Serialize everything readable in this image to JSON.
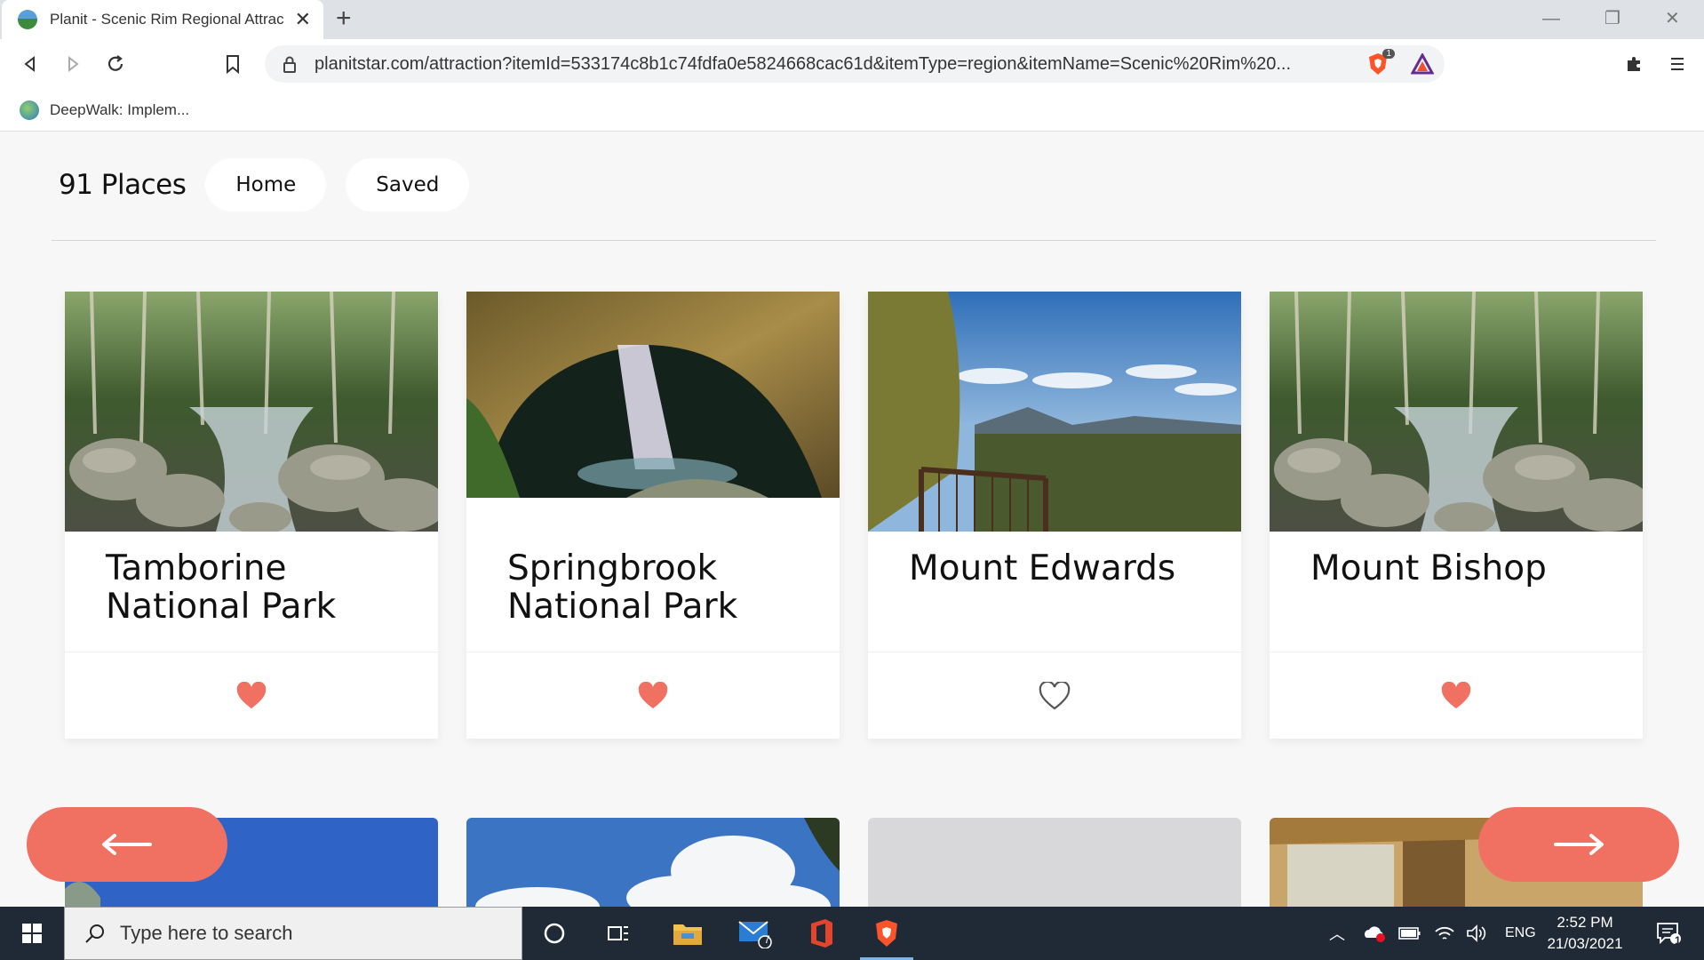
{
  "browser": {
    "tab_title": "Planit - Scenic Rim Regional Attrac",
    "url": "planitstar.com/attraction?itemId=533174c8b1c74fdfa0e5824668cac61d&itemType=region&itemName=Scenic%20Rim%20...",
    "shield_count": "1",
    "bookmark_label": "DeepWalk: Implem..."
  },
  "page": {
    "places_count": "91 Places",
    "nav": [
      "Home",
      "Saved"
    ],
    "cards": [
      {
        "title": "Tamborine National Park",
        "favorited": true
      },
      {
        "title": "Springbrook National Park",
        "favorited": true
      },
      {
        "title": "Mount Edwards",
        "favorited": false
      },
      {
        "title": "Mount Bishop",
        "favorited": true
      }
    ]
  },
  "taskbar": {
    "search_placeholder": "Type here to search",
    "mail_badge": "7",
    "language": "ENG",
    "time": "2:52 PM",
    "date": "21/03/2021",
    "notification_count": "1"
  },
  "colors": {
    "accent": "#f07162",
    "heart_filled": "#f07162",
    "heart_outline": "#555555"
  }
}
